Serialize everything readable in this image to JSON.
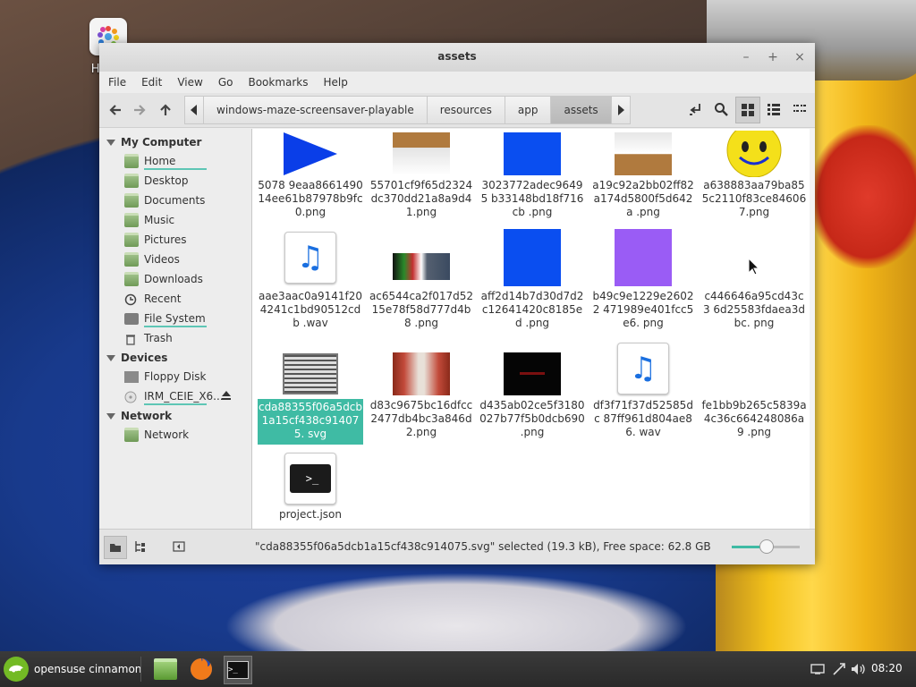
{
  "desktop": {
    "icon_label": "Home"
  },
  "window": {
    "title": "assets",
    "controls": [
      "–",
      "+",
      "×"
    ]
  },
  "menubar": [
    "File",
    "Edit",
    "View",
    "Go",
    "Bookmarks",
    "Help"
  ],
  "breadcrumbs": [
    "windows-maze-screensaver-playable",
    "resources",
    "app",
    "assets"
  ],
  "sidebar": {
    "my_computer": {
      "heading": "My Computer",
      "items": [
        "Home",
        "Desktop",
        "Documents",
        "Music",
        "Pictures",
        "Videos",
        "Downloads",
        "Recent",
        "File System",
        "Trash"
      ]
    },
    "devices": {
      "heading": "Devices",
      "items": [
        "Floppy Disk",
        "IRM_CEIE_X6..."
      ]
    },
    "network": {
      "heading": "Network",
      "items": [
        "Network"
      ]
    }
  },
  "files": [
    {
      "name": "5078 9eaa8661490 14ee61b87978b9fc 0.png",
      "kind": "blue-arrow"
    },
    {
      "name": "55701cf9f65d2324 dc370dd21a8a9d4 1.png",
      "kind": "floor-wood"
    },
    {
      "name": "3023772adec96495 b33148bd18f716cb .png",
      "kind": "blue-square"
    },
    {
      "name": "a19c92a2bb02ff82 a174d5800f5d642a .png",
      "kind": "floor-wood"
    },
    {
      "name": "a638883aa79ba85 5c2110f83ce84606 7.png",
      "kind": "smiley"
    },
    {
      "name": "aae3aac0a9141f20 4241c1bd90512cdb .wav",
      "kind": "music"
    },
    {
      "name": "ac6544ca2f017d52 15e78f58d777d4b8 .png",
      "kind": "strip"
    },
    {
      "name": "aff2d14b7d30d7d2 c12641420c8185ed .png",
      "kind": "blue-square"
    },
    {
      "name": "b49c9e1229e26022 471989e401fcc5e6. png",
      "kind": "purple-square"
    },
    {
      "name": "c446646a95cd43c3 6d25583fdaea3dbc. png",
      "kind": "blank"
    },
    {
      "name": "cda88355f06a5dcb 1a15cf438c914075. svg",
      "kind": "maze",
      "selected": true
    },
    {
      "name": "d83c9675bc16dfcc 2477db4bc3a846d 2.png",
      "kind": "brick"
    },
    {
      "name": "d435ab02ce5f3180 027b77f5b0dcb690 .png",
      "kind": "black"
    },
    {
      "name": "df3f71f37d52585dc 87ff961d804ae86. wav",
      "kind": "music"
    },
    {
      "name": "fe1bb9b265c5839a 4c36c664248086a9 .png",
      "kind": "blank"
    },
    {
      "name": "project.json",
      "kind": "terminal"
    }
  ],
  "statusbar": {
    "text": "\"cda88355f06a5dcb1a15cf438c914075.svg\" selected (19.3 kB), Free space: 62.8 GB",
    "zoom_fraction": 0.5
  },
  "taskbar": {
    "menu_label": "opensuse cinnamon",
    "clock": "08:20"
  },
  "colors": {
    "accent": "#3fbba4",
    "selection_text": "#ffffff"
  }
}
